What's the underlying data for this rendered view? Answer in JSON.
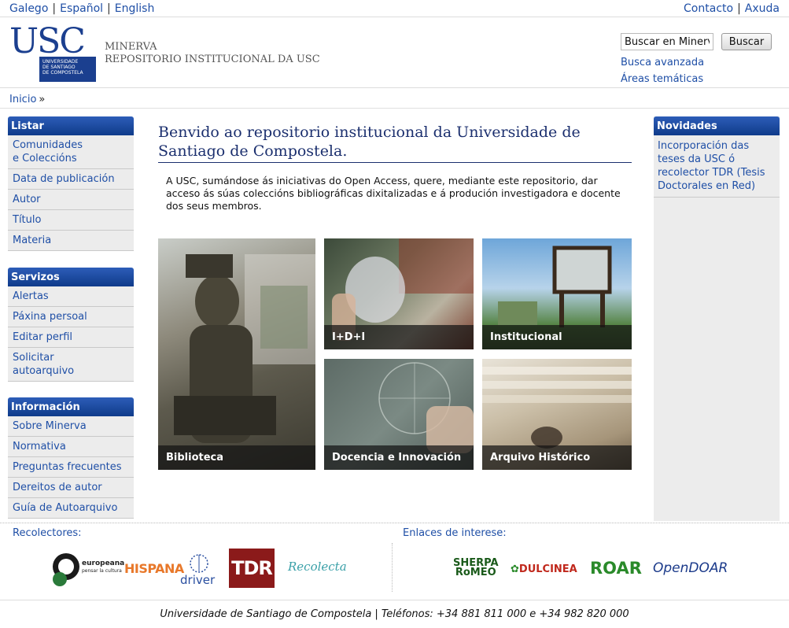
{
  "topbar": {
    "languages": [
      "Galego",
      "Español",
      "English"
    ],
    "separator": "|",
    "contact": "Contacto",
    "help": "Axuda"
  },
  "header": {
    "logo_text": "USC",
    "logo_box_line1": "UNIVERSIDADE",
    "logo_box_line2": "DE SANTIAGO",
    "logo_box_line3": "DE COMPOSTELA",
    "site_name_line1": "MINERVA",
    "site_name_line2": "REPOSITORIO INSTITUCIONAL DA USC",
    "search_value": "Buscar en Minerva",
    "search_button": "Buscar",
    "advanced_search": "Busca avanzada",
    "areas": "Áreas temáticas"
  },
  "breadcrumb": {
    "home": "Inicio",
    "sep": "»"
  },
  "sidebar": {
    "listar": {
      "title": "Listar",
      "items": [
        "Comunidades",
        "e Coleccións",
        "Data de publicación",
        "Autor",
        "Título",
        "Materia"
      ]
    },
    "servizos": {
      "title": "Servizos",
      "items": [
        "Alertas",
        "Páxina persoal",
        "Editar perfil",
        "Solicitar",
        "autoarquivo"
      ]
    },
    "informacion": {
      "title": "Información",
      "items": [
        "Sobre Minerva",
        "Normativa",
        "Preguntas frecuentes",
        "Dereitos de autor",
        "Guía de Autoarquivo"
      ]
    }
  },
  "main": {
    "title_line1": "Benvido ao repositorio institucional da Universidade de",
    "title_line2": "Santiago de Compostela.",
    "intro": "A USC, sumándose ás iniciativas do Open Access, quere, mediante este repositorio, dar acceso ás súas coleccións bibliográficas dixitalizadas e á produción investigadora e docente dos seus membros.",
    "tiles": [
      "Biblioteca",
      "I+D+I",
      "Institucional",
      "Docencia e Innovación",
      "Arquivo Histórico"
    ]
  },
  "novidades": {
    "title": "Novidades",
    "items": [
      "Incorporación das",
      "teses da USC ó",
      "recolector TDR (Tesis",
      "Doctorales en Red)"
    ]
  },
  "footer": {
    "recolectores": "Recolectores:",
    "enlaces": "Enlaces de interese:",
    "rec_logos": [
      "europeana",
      "pensar la cultura",
      "HISPANA",
      "driver",
      "TDR",
      "Recolecta"
    ],
    "link_logos": [
      "SHERPA",
      "RoMEO",
      "DULCINEA",
      "ROAR",
      "OpenDOAR"
    ],
    "bottom": "Universidade de Santiago de Compostela | Teléfonos: +34 881 811 000 e +34 982 820 000"
  }
}
